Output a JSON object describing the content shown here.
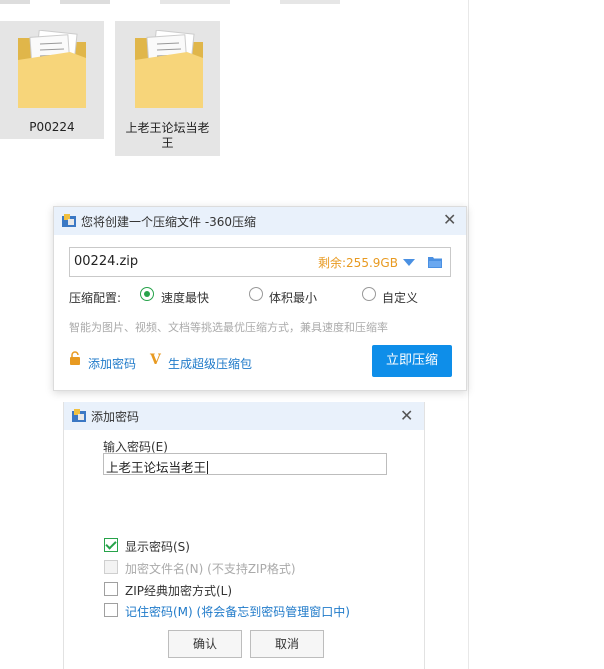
{
  "explorer": {
    "folders": [
      {
        "name": "P00224"
      },
      {
        "name": "上老王论坛当老王"
      }
    ]
  },
  "compress_dialog": {
    "title": "您将创建一个压缩文件 -360压缩",
    "filename": "00224.zip",
    "free_space": "剩余:255.9GB",
    "config_label": "压缩配置:",
    "options": [
      "速度最快",
      "体积最小",
      "自定义"
    ],
    "selected_option": "速度最快",
    "hint": "智能为图片、视频、文档等挑选最优压缩方式，兼具速度和压缩率",
    "add_password": "添加密码",
    "super_package": "生成超级压缩包",
    "compress_button": "立即压缩"
  },
  "password_dialog": {
    "title": "添加密码",
    "input_label": "输入密码(E)",
    "password_value": "上老王论坛当老王",
    "checkboxes": [
      {
        "label": "显示密码(S)",
        "checked": true,
        "disabled": false
      },
      {
        "label": "加密文件名(N) (不支持ZIP格式)",
        "checked": false,
        "disabled": true
      },
      {
        "label": "ZIP经典加密方式(L)",
        "checked": false,
        "disabled": false
      },
      {
        "label": "记住密码(M) (将会备忘到密码管理窗口中)",
        "checked": false,
        "disabled": false
      }
    ],
    "ok_button": "确认",
    "cancel_button": "取消"
  },
  "colors": {
    "accent": "#0e8ee9",
    "check_green": "#27a34a",
    "free_space_orange": "#e89a21",
    "link_blue": "#1f7ac9",
    "title_bar": "#e9f1fb"
  }
}
